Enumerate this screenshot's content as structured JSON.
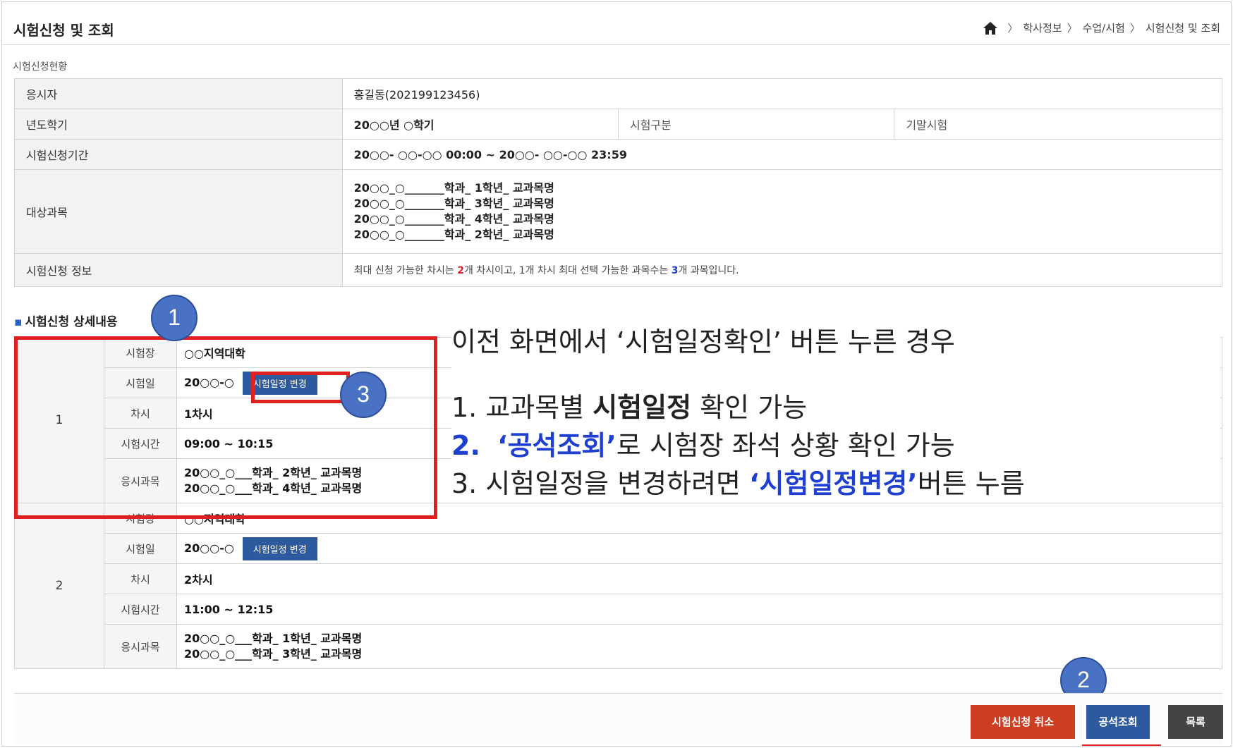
{
  "header": {
    "title": "시험신청 및 조회",
    "breadcrumb": [
      "학사정보",
      "수업/시험",
      "시험신청 및 조회"
    ]
  },
  "status_section": {
    "label": "시험신청현황",
    "applicant_label": "응시자",
    "applicant_value": "홍길동(202199123456)",
    "term_label": "년도학기",
    "term_value": "20○○년 ○학기",
    "exam_type_label": "시험구분",
    "exam_type_value": "기말시험",
    "period_label": "시험신청기간",
    "period_value": "20○○- ○○-○○ 00:00 ~ 20○○- ○○-○○ 23:59",
    "subjects_label": "대상과목",
    "subjects": [
      "20○○_○_______학과_ 1학년_ 교과목명",
      "20○○_○_______학과_ 3학년_ 교과목명",
      "20○○_○_______학과_ 4학년_ 교과목명",
      "20○○_○_______학과_ 2학년_ 교과목명"
    ],
    "info_label": "시험신청 정보",
    "info_parts": [
      "최대 신청 가능한 차시는 ",
      "2",
      "개 차시이고, 1개 차시 최대 선택 가능한 과목수는 ",
      "3",
      "개 과목입니다."
    ]
  },
  "detail": {
    "title": "시험신청 상세내용",
    "change_button": "시험일정 변경",
    "labels": {
      "venue": "시험장",
      "date": "시험일",
      "session": "차시",
      "time": "시험시간",
      "subjects": "응시과목"
    },
    "rows": [
      {
        "no": "1",
        "venue": "○○지역대학",
        "date": "20○○-○",
        "session": "1차시",
        "time": "09:00 ~ 10:15",
        "subjects": [
          "20○○_○___학과_ 2학년_ 교과목명",
          "20○○_○___학과_ 4학년_ 교과목명"
        ]
      },
      {
        "no": "2",
        "venue": "○○지역대학",
        "date": "20○○-○",
        "session": "2차시",
        "time": "11:00 ~ 12:15",
        "subjects": [
          "20○○_○___학과_ 1학년_ 교과목명",
          "20○○_○___학과_ 3학년_ 교과목명"
        ]
      }
    ]
  },
  "callout": {
    "title": "이전 화면에서 ‘시험일정확인’ 버튼 누른 경우",
    "line1_pre": "1.  교과목별 ",
    "line1_bold": "시험일정",
    "line1_post": " 확인 가능",
    "line2_num": "2.",
    "line2_hl": "‘공석조회’",
    "line2_post": "로 시험장 좌석 상황 확인 가능",
    "line3_pre": "3.  시험일정을 변경하려면 ",
    "line3_hl": "‘시험일정변경’",
    "line3_post": "버튼 누름"
  },
  "badges": [
    "1",
    "2",
    "3"
  ],
  "footer": {
    "cancel_button": "시험신청 취소",
    "seat_button": "공석조회",
    "list_button": "목록"
  }
}
